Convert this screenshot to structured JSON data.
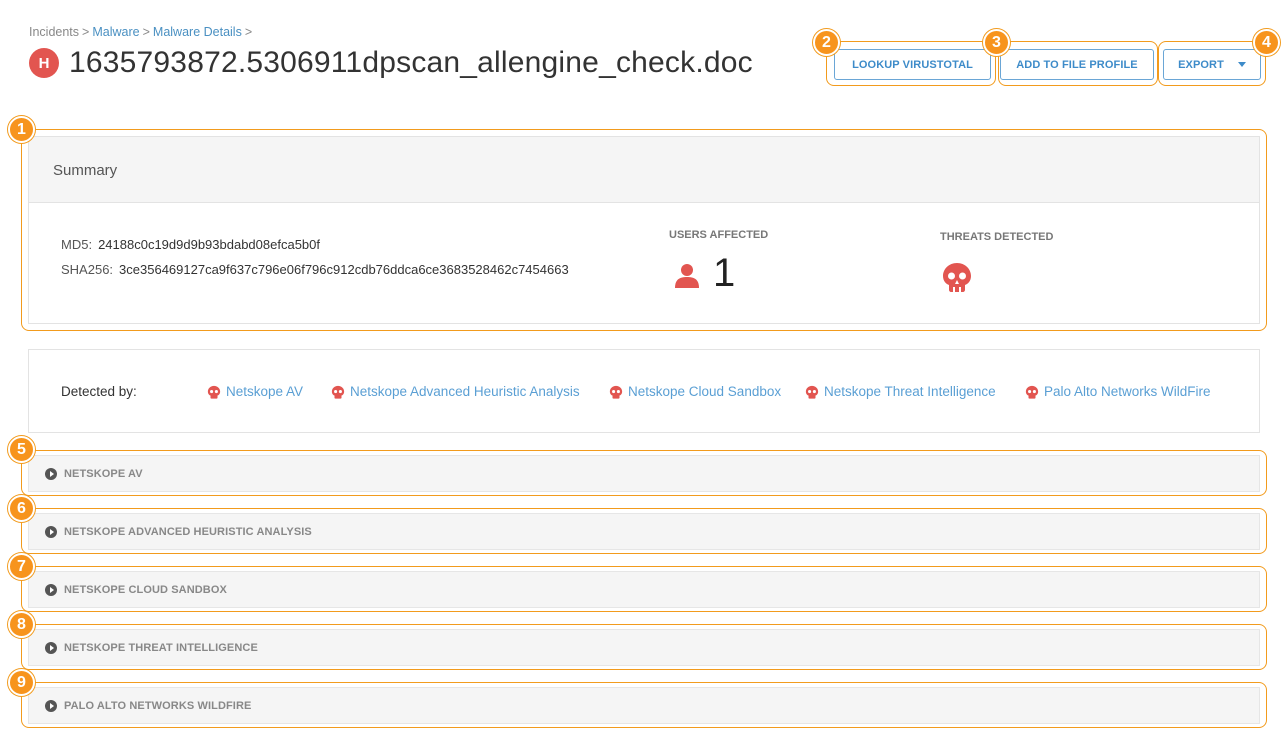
{
  "breadcrumb": {
    "root": "Incidents",
    "link1": "Malware",
    "link2": "Malware Details",
    "separator": ">"
  },
  "header": {
    "severity_badge": "H",
    "title": "1635793872.5306911dpscan_allengine_check.doc"
  },
  "toolbar": {
    "lookup_label": "LOOKUP VIRUSTOTAL",
    "add_profile_label": "ADD TO FILE PROFILE",
    "export_label": "EXPORT"
  },
  "callouts": [
    "1",
    "2",
    "3",
    "4",
    "5",
    "6",
    "7",
    "8",
    "9"
  ],
  "summary": {
    "heading": "Summary",
    "md5_label": "MD5:",
    "md5_value": "24188c0c19d9d9b93bdabd08efca5b0f",
    "sha256_label": "SHA256:",
    "sha256_value": "3ce356469127ca9f637c796e06f796c912cdb76ddca6ce3683528462c7454663",
    "users_affected_label": "USERS AFFECTED",
    "users_affected_count": "1",
    "threats_detected_label": "THREATS DETECTED"
  },
  "detection": {
    "label": "Detected by:",
    "engines": [
      "Netskope AV",
      "Netskope Advanced Heuristic Analysis",
      "Netskope Cloud Sandbox",
      "Netskope Threat Intelligence",
      "Palo Alto Networks WildFire"
    ]
  },
  "sections": [
    "NETSKOPE AV",
    "NETSKOPE ADVANCED HEURISTIC ANALYSIS",
    "NETSKOPE CLOUD SANDBOX",
    "NETSKOPE THREAT INTELLIGENCE",
    "PALO ALTO NETWORKS WILDFIRE"
  ],
  "colors": {
    "accent_blue": "#3d8bc9",
    "link_blue": "#5a9fd4",
    "threat_red": "#e25550",
    "callout_orange": "#f7941d"
  }
}
